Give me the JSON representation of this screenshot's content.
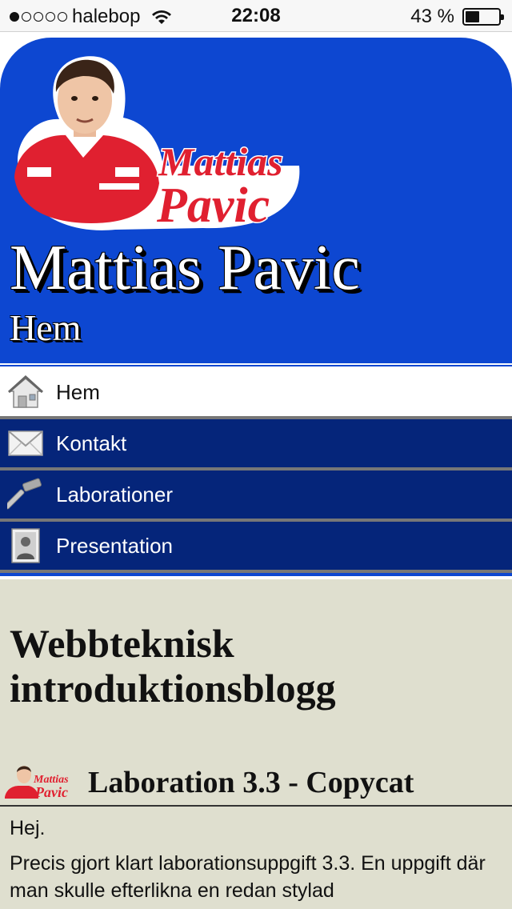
{
  "status_bar": {
    "carrier": "halebop",
    "time": "22:08",
    "battery": "43 %",
    "battery_level": 0.43,
    "signal_bars": 1
  },
  "header": {
    "logo_text_line1": "Mattias",
    "logo_text_line2": "Pavic",
    "site_title": "Mattias Pavic",
    "page_subtitle": "Hem",
    "accent_color": "#0d47d1"
  },
  "nav": {
    "items": [
      {
        "label": "Hem",
        "icon": "house-icon",
        "active": true
      },
      {
        "label": "Kontakt",
        "icon": "envelope-icon",
        "active": false
      },
      {
        "label": "Laborationer",
        "icon": "hammer-icon",
        "active": false
      },
      {
        "label": "Presentation",
        "icon": "portrait-icon",
        "active": false
      }
    ]
  },
  "content": {
    "blog_title": "Webbteknisk introduktionsblogg",
    "post": {
      "title": "Laboration 3.3 - Copycat",
      "greeting": "Hej.",
      "text": "Precis gjort klart laborationsuppgift 3.3. En uppgift där man skulle efterlikna en redan stylad"
    }
  }
}
